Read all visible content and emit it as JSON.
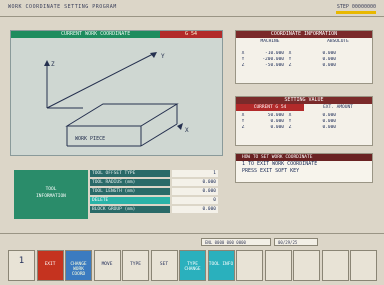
{
  "window": {
    "title": "WORK COORDINATE SETTING PROGRAM",
    "clock": "STEP 00000000"
  },
  "diagram": {
    "header": "CURRENT WORK COORDINATE",
    "axis_label": "G 54",
    "axis_x": "X",
    "axis_y": "Y",
    "axis_z": "Z",
    "piece_label": "WORK PIECE"
  },
  "coordinate_panel": {
    "header": "COORDINATE INFORMATION",
    "col_machine": "MACHINE",
    "col_absolute": "ABSOLUTE",
    "rows": [
      {
        "axis": "X",
        "machine": "-10.000",
        "axis2": "X",
        "absolute": "0.000"
      },
      {
        "axis": "Y",
        "machine": "-200.000",
        "axis2": "Y",
        "absolute": "0.000"
      },
      {
        "axis": "Z",
        "machine": "-50.000",
        "axis2": "Z",
        "absolute": "0.000"
      }
    ]
  },
  "setting_panel": {
    "header": "SETTING VALUE",
    "tab_current": "CURRENT G 54",
    "tab_ext": "EXT. AMOUNT",
    "rows": [
      {
        "axis": "X",
        "current": "50.000",
        "axis2": "X",
        "ext": "0.000"
      },
      {
        "axis": "Y",
        "current": "0.000",
        "axis2": "Y",
        "ext": "0.000"
      },
      {
        "axis": "Z",
        "current": "0.000",
        "axis2": "Z",
        "ext": "0.000"
      }
    ]
  },
  "message_panel": {
    "header": "HOW TO SET WORK COORDINATE",
    "line1": "1 TO EXIT WORK COORDINATE",
    "line2": "PRESS EXIT SOFT KEY"
  },
  "tool_panel": {
    "title1": "TOOL",
    "title2": "INFORMATION",
    "rows": [
      {
        "label": "TOOL OFFSET TYPE",
        "value": "1"
      },
      {
        "label": "TOOL RADIUS (mm)",
        "value": "0.000"
      },
      {
        "label": "TOOL LENGTH (mm)",
        "value": "0.000"
      },
      {
        "label": "DELETE",
        "value": "0"
      },
      {
        "label": "BLOCK GROUP (mm)",
        "value": "0.000"
      }
    ]
  },
  "entry": {
    "mode": "ENL 0000 000 0000",
    "position": "00/29/25"
  },
  "softkeys": [
    {
      "label": "1",
      "style": ""
    },
    {
      "label": "EXIT",
      "style": "red"
    },
    {
      "label": "CHANGE WORK COORD",
      "style": "blue"
    },
    {
      "label": "MOVE",
      "style": ""
    },
    {
      "label": "TYPE",
      "style": ""
    },
    {
      "label": "SET",
      "style": ""
    },
    {
      "label": "TYPE CHANGE",
      "style": "cyan"
    },
    {
      "label": "TOOL INFO",
      "style": "cyan"
    },
    {
      "label": "",
      "style": ""
    },
    {
      "label": "",
      "style": ""
    },
    {
      "label": "",
      "style": ""
    },
    {
      "label": "",
      "style": ""
    },
    {
      "label": "",
      "style": ""
    }
  ]
}
